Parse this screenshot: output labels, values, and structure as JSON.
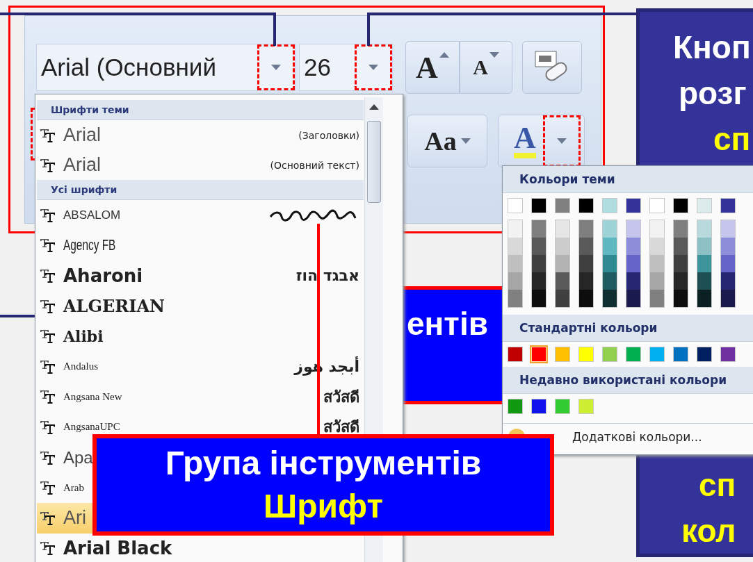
{
  "ribbon": {
    "font_name": "Arial (Основний",
    "font_size": "26",
    "buttons": [
      {
        "kind": "grow",
        "glyph": "A"
      },
      {
        "kind": "shrink",
        "glyph": "A"
      },
      {
        "kind": "clear"
      },
      {
        "kind": "case",
        "glyph": "Aa"
      },
      {
        "kind": "color",
        "glyph": "A"
      }
    ]
  },
  "font_menu": {
    "sections": [
      {
        "title": "Шрифти теми",
        "items": [
          {
            "name": "Arial",
            "note": "(Заголовки)",
            "kind": "theme",
            "selected": false
          },
          {
            "name": "Arial",
            "note": "(Основний текст)",
            "kind": "theme",
            "selected": false
          }
        ]
      },
      {
        "title": "Усі шрифти",
        "items": [
          {
            "name": "ABSALOM",
            "kind": "caps",
            "script_sample": true,
            "selected": false
          },
          {
            "name": "Agency FB",
            "kind": "condensed",
            "selected": false
          },
          {
            "name": "Aharoni",
            "note": "אבגד הוז",
            "kind": "bold",
            "selected": false
          },
          {
            "name": "ALGERIAN",
            "kind": "serif-bold",
            "selected": false
          },
          {
            "name": "Alibi",
            "kind": "blackletter",
            "selected": false
          },
          {
            "name": "Andalus",
            "note": "أبجد هوز",
            "kind": "small-serif",
            "selected": false
          },
          {
            "name": "Angsana New",
            "note": "สวัสดี",
            "kind": "small-serif",
            "selected": false
          },
          {
            "name": "AngsanaUPC",
            "note": "สวัสดี",
            "kind": "small-serif",
            "selected": false
          },
          {
            "name": "Apa",
            "kind": "plain",
            "selected": false
          },
          {
            "name": "Arab",
            "kind": "small-serif",
            "selected": false
          },
          {
            "name": "Ari",
            "kind": "theme",
            "selected": true
          },
          {
            "name": "Arial Black",
            "kind": "bold",
            "selected": false
          }
        ]
      }
    ]
  },
  "color_menu": {
    "theme_title": "Кольори теми",
    "theme_columns": [
      {
        "color": "#ffffff",
        "shades": [
          {
            "color": "#f2f2f2"
          },
          {
            "color": "#d9d9d9"
          },
          {
            "color": "#bfbfbf"
          },
          {
            "color": "#a6a6a6"
          },
          {
            "color": "#808080"
          }
        ]
      },
      {
        "color": "#000000",
        "shades": [
          {
            "color": "#7f7f7f"
          },
          {
            "color": "#595959"
          },
          {
            "color": "#3f3f3f"
          },
          {
            "color": "#262626"
          },
          {
            "color": "#0d0d0d"
          }
        ]
      },
      {
        "color": "#808080",
        "shades": [
          {
            "color": "#e6e6e6"
          },
          {
            "color": "#cccccc"
          },
          {
            "color": "#b3b3b3"
          },
          {
            "color": "#595959"
          },
          {
            "color": "#404040"
          }
        ]
      },
      {
        "color": "#000000",
        "shades": [
          {
            "color": "#7f7f7f"
          },
          {
            "color": "#595959"
          },
          {
            "color": "#3f3f3f"
          },
          {
            "color": "#262626"
          },
          {
            "color": "#0d0d0d"
          }
        ]
      },
      {
        "color": "#b0dde0",
        "shades": [
          {
            "color": "#9ed3d8"
          },
          {
            "color": "#5fb8c0"
          },
          {
            "color": "#2f8a92"
          },
          {
            "color": "#1f5c61"
          },
          {
            "color": "#0f2e30"
          }
        ]
      },
      {
        "color": "#333399",
        "shades": [
          {
            "color": "#c6c6ec"
          },
          {
            "color": "#8d8dd9"
          },
          {
            "color": "#6565c9"
          },
          {
            "color": "#262673"
          },
          {
            "color": "#1a1a4d"
          }
        ]
      },
      {
        "color": "#ffffff",
        "shades": [
          {
            "color": "#f2f2f2"
          },
          {
            "color": "#d9d9d9"
          },
          {
            "color": "#bfbfbf"
          },
          {
            "color": "#a6a6a6"
          },
          {
            "color": "#808080"
          }
        ]
      },
      {
        "color": "#000000",
        "shades": [
          {
            "color": "#7f7f7f"
          },
          {
            "color": "#595959"
          },
          {
            "color": "#3f3f3f"
          },
          {
            "color": "#262626"
          },
          {
            "color": "#0d0d0d"
          }
        ]
      },
      {
        "color": "#dcecec",
        "shades": [
          {
            "color": "#b8dadd"
          },
          {
            "color": "#8cc0c4"
          },
          {
            "color": "#3d959b"
          },
          {
            "color": "#1e5053"
          },
          {
            "color": "#0b2022"
          }
        ]
      },
      {
        "color": "#333399",
        "shades": [
          {
            "color": "#c6c6ec"
          },
          {
            "color": "#8d8dd9"
          },
          {
            "color": "#6565c9"
          },
          {
            "color": "#262673"
          },
          {
            "color": "#1a1a4d"
          }
        ]
      }
    ],
    "standard_title": "Стандартні кольори",
    "standard": [
      {
        "color": "#c00000",
        "selected": false
      },
      {
        "color": "#ff0000",
        "selected": true
      },
      {
        "color": "#ffc000",
        "selected": false
      },
      {
        "color": "#ffff00",
        "selected": false
      },
      {
        "color": "#92d050",
        "selected": false
      },
      {
        "color": "#00b050",
        "selected": false
      },
      {
        "color": "#00b0f0",
        "selected": false
      },
      {
        "color": "#0070c0",
        "selected": false
      },
      {
        "color": "#002060",
        "selected": false
      },
      {
        "color": "#7030a0",
        "selected": false
      }
    ],
    "recent_title": "Недавно використані кольори",
    "recent": [
      {
        "color": "#119911"
      },
      {
        "color": "#1111ee"
      },
      {
        "color": "#33cc33"
      },
      {
        "color": "#ccee33"
      }
    ],
    "more": "Додаткові кольори..."
  },
  "callouts": [
    {
      "kind": "top-right",
      "lines": [
        {
          "text": "Кноп",
          "accent": false
        },
        {
          "text": "розг",
          "accent": false
        },
        {
          "text": "сп",
          "accent": true
        }
      ]
    },
    {
      "kind": "middle",
      "lines": [
        {
          "text": "ентів",
          "accent": false
        }
      ]
    },
    {
      "kind": "bottom-right",
      "lines": [
        {
          "text": "сп",
          "accent": true
        },
        {
          "text": "кол",
          "accent": true
        }
      ]
    },
    {
      "kind": "main",
      "lines": [
        {
          "text": "Група інструментів",
          "accent": false
        },
        {
          "text": "Шрифт",
          "accent": true
        }
      ]
    }
  ]
}
